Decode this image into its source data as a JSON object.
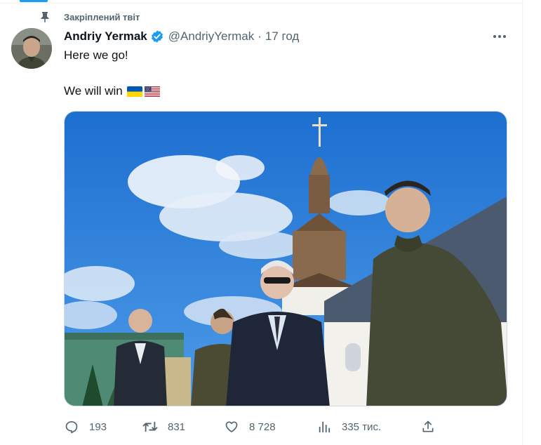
{
  "pinned": {
    "label": "Закріплений твіт",
    "icon": "pin-icon"
  },
  "author": {
    "display_name": "Andriy Yermak",
    "handle": "@AndriyYermak",
    "separator": "·",
    "timestamp": "17 год",
    "verified": true
  },
  "tweet": {
    "line1": "Here we go!",
    "line2": "We will win",
    "flags": [
      "ukraine-flag",
      "usa-flag"
    ]
  },
  "actions": {
    "replies": "193",
    "retweets": "831",
    "likes": "8 728",
    "views": "335 тис."
  },
  "colors": {
    "accent": "#1d9bf0",
    "secondary_text": "#536471",
    "primary_text": "#0f1419"
  }
}
